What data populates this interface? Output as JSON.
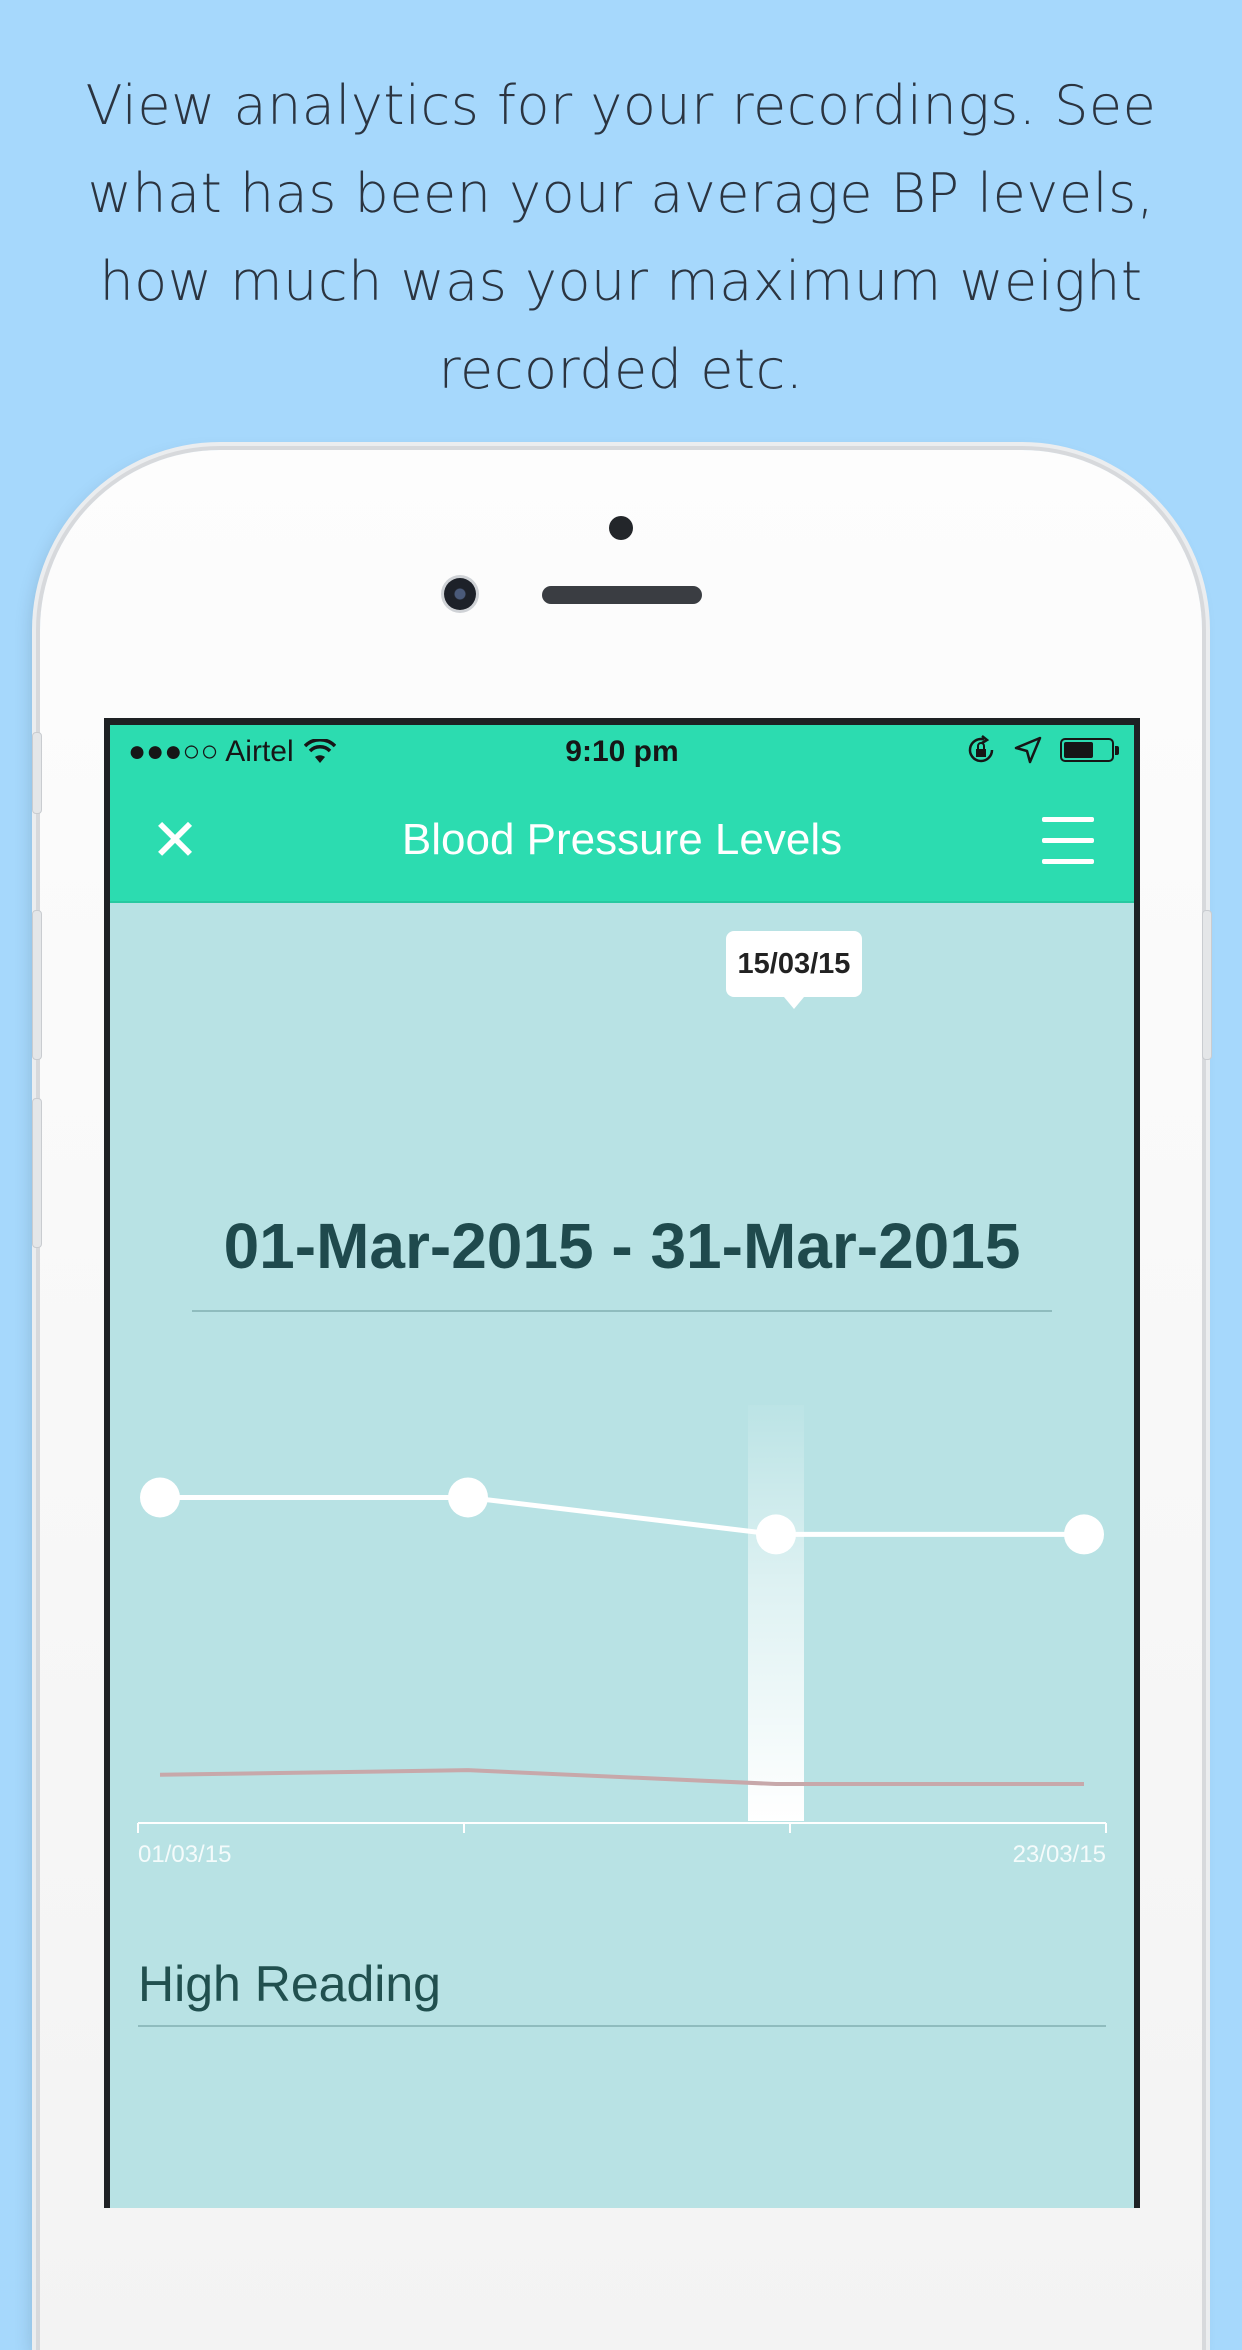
{
  "headline": "View analytics for your recordings. See what has been your average BP levels, how much was your maximum weight recorded etc.",
  "status_bar": {
    "carrier": "●●●○○ Airtel",
    "time": "9:10 pm"
  },
  "nav": {
    "title": "Blood Pressure Levels",
    "close_icon": "close-icon",
    "menu_icon": "hamburger-menu-icon"
  },
  "tooltip": "15/03/15",
  "date_range": "01-Mar-2015 - 31-Mar-2015",
  "section_title": "High Reading",
  "colors": {
    "background": "#a6d8fc",
    "accent": "#2cdcb0",
    "chart_bg": "#b8e2e4",
    "secondary_line": "#c7a8aa"
  },
  "chart_data": {
    "type": "line",
    "x_tick_labels": [
      "01/03/15",
      "",
      "",
      "23/03/15"
    ],
    "selected_index": 2,
    "series": [
      {
        "values": [
          140,
          140,
          124,
          124
        ]
      },
      {
        "values": [
          20,
          22,
          16,
          16
        ]
      }
    ],
    "ylim": [
      0,
      180
    ],
    "grid": false
  }
}
